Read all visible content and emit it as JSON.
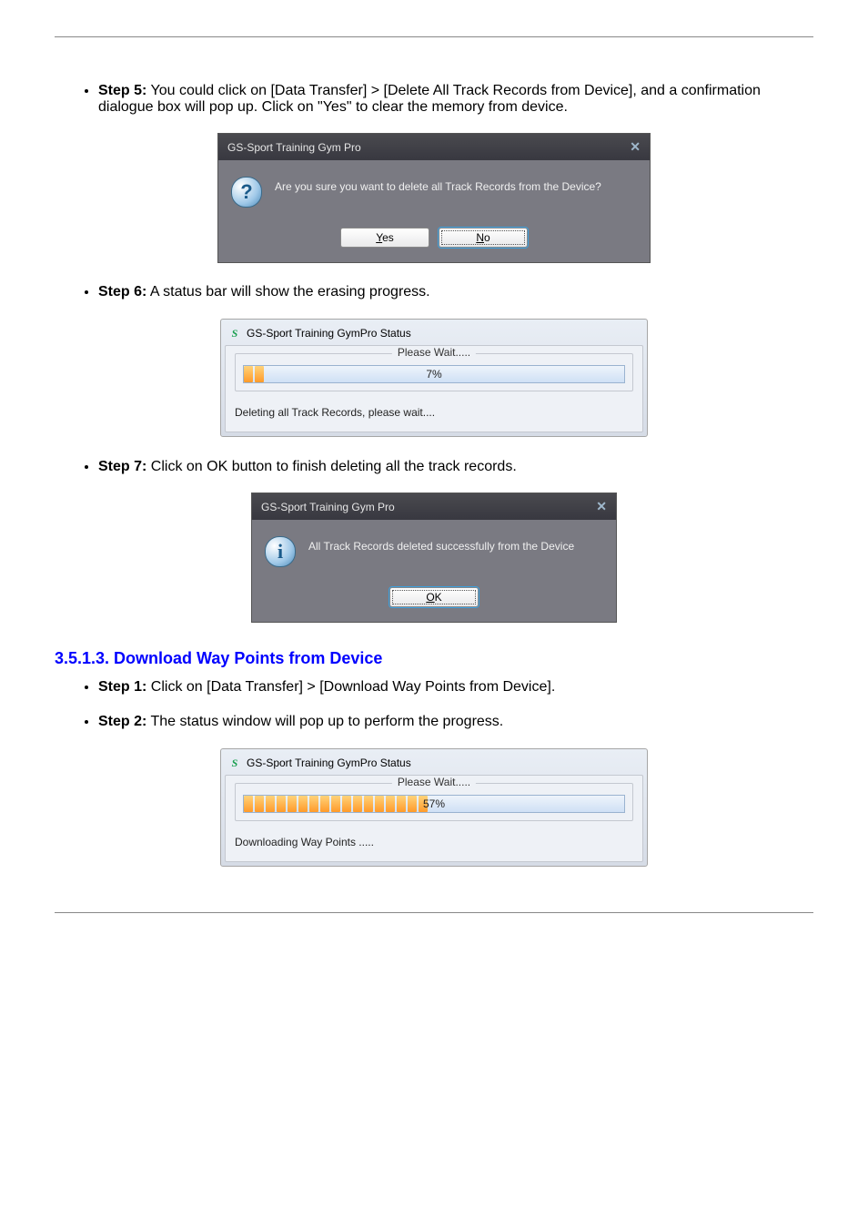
{
  "dialog_confirm": {
    "title": "GS-Sport Training Gym Pro",
    "icon_name": "question-icon",
    "icon_text": "?",
    "message": "Are you sure you want to delete all Track Records from the Device?",
    "yes_mn": "Y",
    "yes_rest": "es",
    "no_mn": "N",
    "no_rest": "o"
  },
  "progress_delete": {
    "title": "GS-Sport Training GymPro Status",
    "fieldset_label": "Please Wait.....",
    "percent_label": "7%",
    "status": "Deleting all Track Records, please wait....",
    "segments": 2
  },
  "dialog_success": {
    "title": "GS-Sport Training Gym Pro",
    "icon_name": "info-icon",
    "icon_text": "i",
    "message": "All Track Records deleted successfully from the Device",
    "ok_mn": "O",
    "ok_rest": "K"
  },
  "waypoints_section": "3.5.1.3. Download Way Points from Device",
  "bullets_wp_1": "Click on [Data Transfer] > [Download Way Points from Device].",
  "bullets_wp_2": "The status window will pop up to perform the progress.",
  "bullet_step5": "You could click on [Data Transfer] > [Delete All Track Records from Device], and a confirmation dialogue box will pop up. Click on \"Yes\" to clear the memory from device.",
  "bullet_step6": "A status bar will show the erasing progress.",
  "bullet_step7": "Click on OK button to finish deleting all the track records.",
  "bullet_prefix_5": "Step 5:",
  "bullet_prefix_6": "Step 6:",
  "bullet_prefix_7": "Step 7:",
  "bullet_prefix_wp1": "Step 1:",
  "bullet_prefix_wp2": "Step 2:",
  "progress_waypoints": {
    "title": "GS-Sport Training GymPro Status",
    "fieldset_label": "Please Wait.....",
    "percent_label": "57%",
    "status": "Downloading Way Points .....",
    "segments": 17
  },
  "chart_data": [
    {
      "type": "bar",
      "title": "Deleting all Track Records progress",
      "categories": [
        "progress"
      ],
      "values": [
        7
      ],
      "xlabel": "",
      "ylabel": "percent",
      "ylim": [
        0,
        100
      ]
    },
    {
      "type": "bar",
      "title": "Downloading Way Points progress",
      "categories": [
        "progress"
      ],
      "values": [
        57
      ],
      "xlabel": "",
      "ylabel": "percent",
      "ylim": [
        0,
        100
      ]
    }
  ]
}
